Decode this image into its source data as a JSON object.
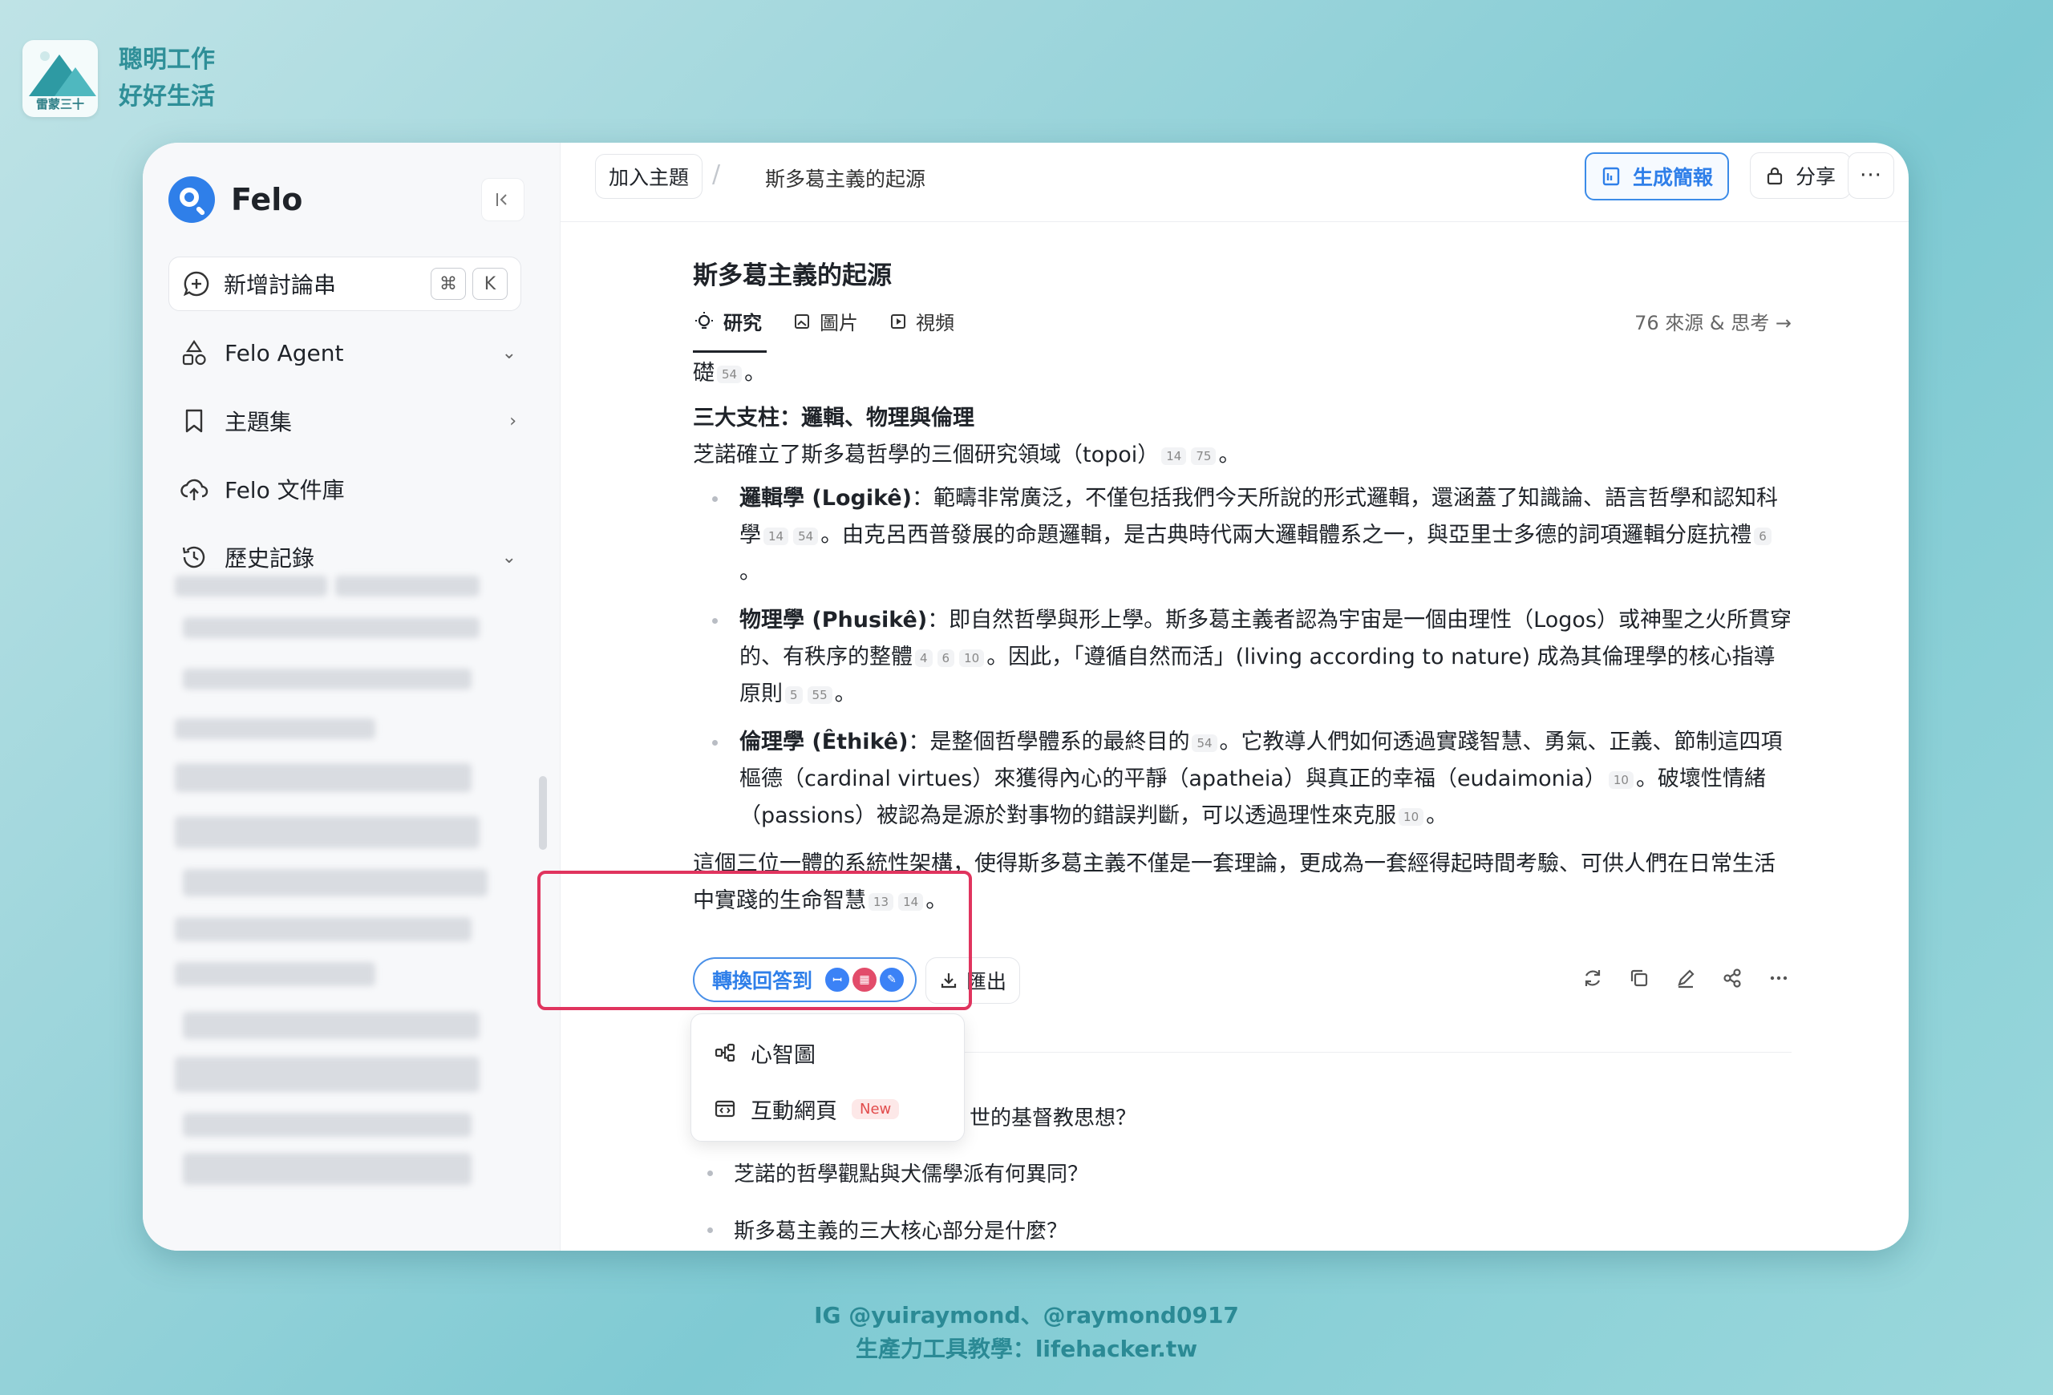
{
  "brand": {
    "line1": "聰明工作",
    "line2": "好好生活",
    "logo_caption": "雷蒙三十"
  },
  "sidebar": {
    "app_name": "Felo",
    "collapse_icon": "collapse-left-icon",
    "new_thread": {
      "label": "新增討論串",
      "kbd1": "⌘",
      "kbd2": "K"
    },
    "items": [
      {
        "label": "Felo Agent",
        "icon": "shapes-icon",
        "chevron": "down"
      },
      {
        "label": "主題集",
        "icon": "bookmark-icon",
        "chevron": "right"
      },
      {
        "label": "Felo 文件庫",
        "icon": "cloud-upload-icon",
        "chevron": ""
      },
      {
        "label": "歷史記錄",
        "icon": "history-icon",
        "chevron": "down"
      }
    ]
  },
  "header": {
    "add_topic": "加入主題",
    "breadcrumb_sep": "/",
    "title": "斯多葛主義的起源",
    "generate_report": "生成簡報",
    "share": "分享",
    "more": "···"
  },
  "question": {
    "title": "斯多葛主義的起源"
  },
  "tabs": [
    {
      "label": "研究",
      "icon": "bulb-icon"
    },
    {
      "label": "圖片",
      "icon": "image-icon"
    },
    {
      "label": "視頻",
      "icon": "play-icon"
    }
  ],
  "sources_label": "76 來源 & 思考 →",
  "answer": {
    "top_fragment": "礎",
    "top_cite": "54",
    "top_end": "。",
    "heading": "三大支柱：邏輯、物理與倫理",
    "intro": "芝諾確立了斯多葛哲學的三個研究領域（topoi）",
    "intro_c1": "14",
    "intro_c2": "75",
    "intro_end": "。",
    "b1_title": "邏輯學 (Logikê)",
    "b1_text1": "：範疇非常廣泛，不僅包括我們今天所說的形式邏輯，還涵蓋了知識論、語言哲學和認知科學",
    "b1_c1": "14",
    "b1_c2": "54",
    "b1_text2": "。由克呂西普發展的命題邏輯，是古典時代兩大邏輯體系之一，與亞里士多德的詞項邏輯分庭抗禮",
    "b1_c3": "6",
    "b1_end": "。",
    "b2_title": "物理學 (Phusikê)",
    "b2_text1": "：即自然哲學與形上學。斯多葛主義者認為宇宙是一個由理性（Logos）或神聖之火所貫穿的、有秩序的整體",
    "b2_c1": "4",
    "b2_c2": "6",
    "b2_c3": "10",
    "b2_text2": "。因此，「遵循自然而活」(living according to nature) 成為其倫理學的核心指導原則",
    "b2_c4": "5",
    "b2_c5": "55",
    "b2_end": "。",
    "b3_title": "倫理學 (Êthikê)",
    "b3_text1": "：是整個哲學體系的最終目的",
    "b3_c1": "54",
    "b3_text2": "。它教導人們如何透過實踐智慧、勇氣、正義、節制這四項樞德（cardinal virtues）來獲得內心的平靜（apatheia）與真正的幸福（eudaimonia）",
    "b3_c2": "10",
    "b3_text3": "。破壞性情緒（passions）被認為是源於對事物的錯誤判斷，可以透過理性來克服",
    "b3_c3": "10",
    "b3_end": "。",
    "conclusion": "這個三位一體的系統性架構，使得斯多葛主義不僅是一套理論，更成為一套經得起時間考驗、可供人們在日常生活中實踐的生命智慧",
    "concl_c1": "13",
    "concl_c2": "14",
    "concl_end": "。"
  },
  "actions": {
    "convert": "轉換回答到",
    "export": "匯出",
    "tool_icons": [
      "refresh-icon",
      "copy-icon",
      "edit-icon",
      "share-icon",
      "more-icon"
    ]
  },
  "dropdown": {
    "items": [
      {
        "label": "心智圖",
        "icon": "mindmap-icon"
      },
      {
        "label": "互動網頁",
        "icon": "webpage-icon",
        "badge": "New"
      }
    ]
  },
  "related": [
    "世的基督教思想？",
    "芝諾的哲學觀點與犬儒學派有何異同？",
    "斯多葛主義的三大核心部分是什麼？"
  ],
  "credits": {
    "line1": "IG @yuiraymond、@raymond0917",
    "line2": "生產力工具教學：lifehacker.tw"
  },
  "colors": {
    "accent": "#2f7fe9",
    "highlight": "#e0345e",
    "badge_red": "#e24c4c"
  }
}
